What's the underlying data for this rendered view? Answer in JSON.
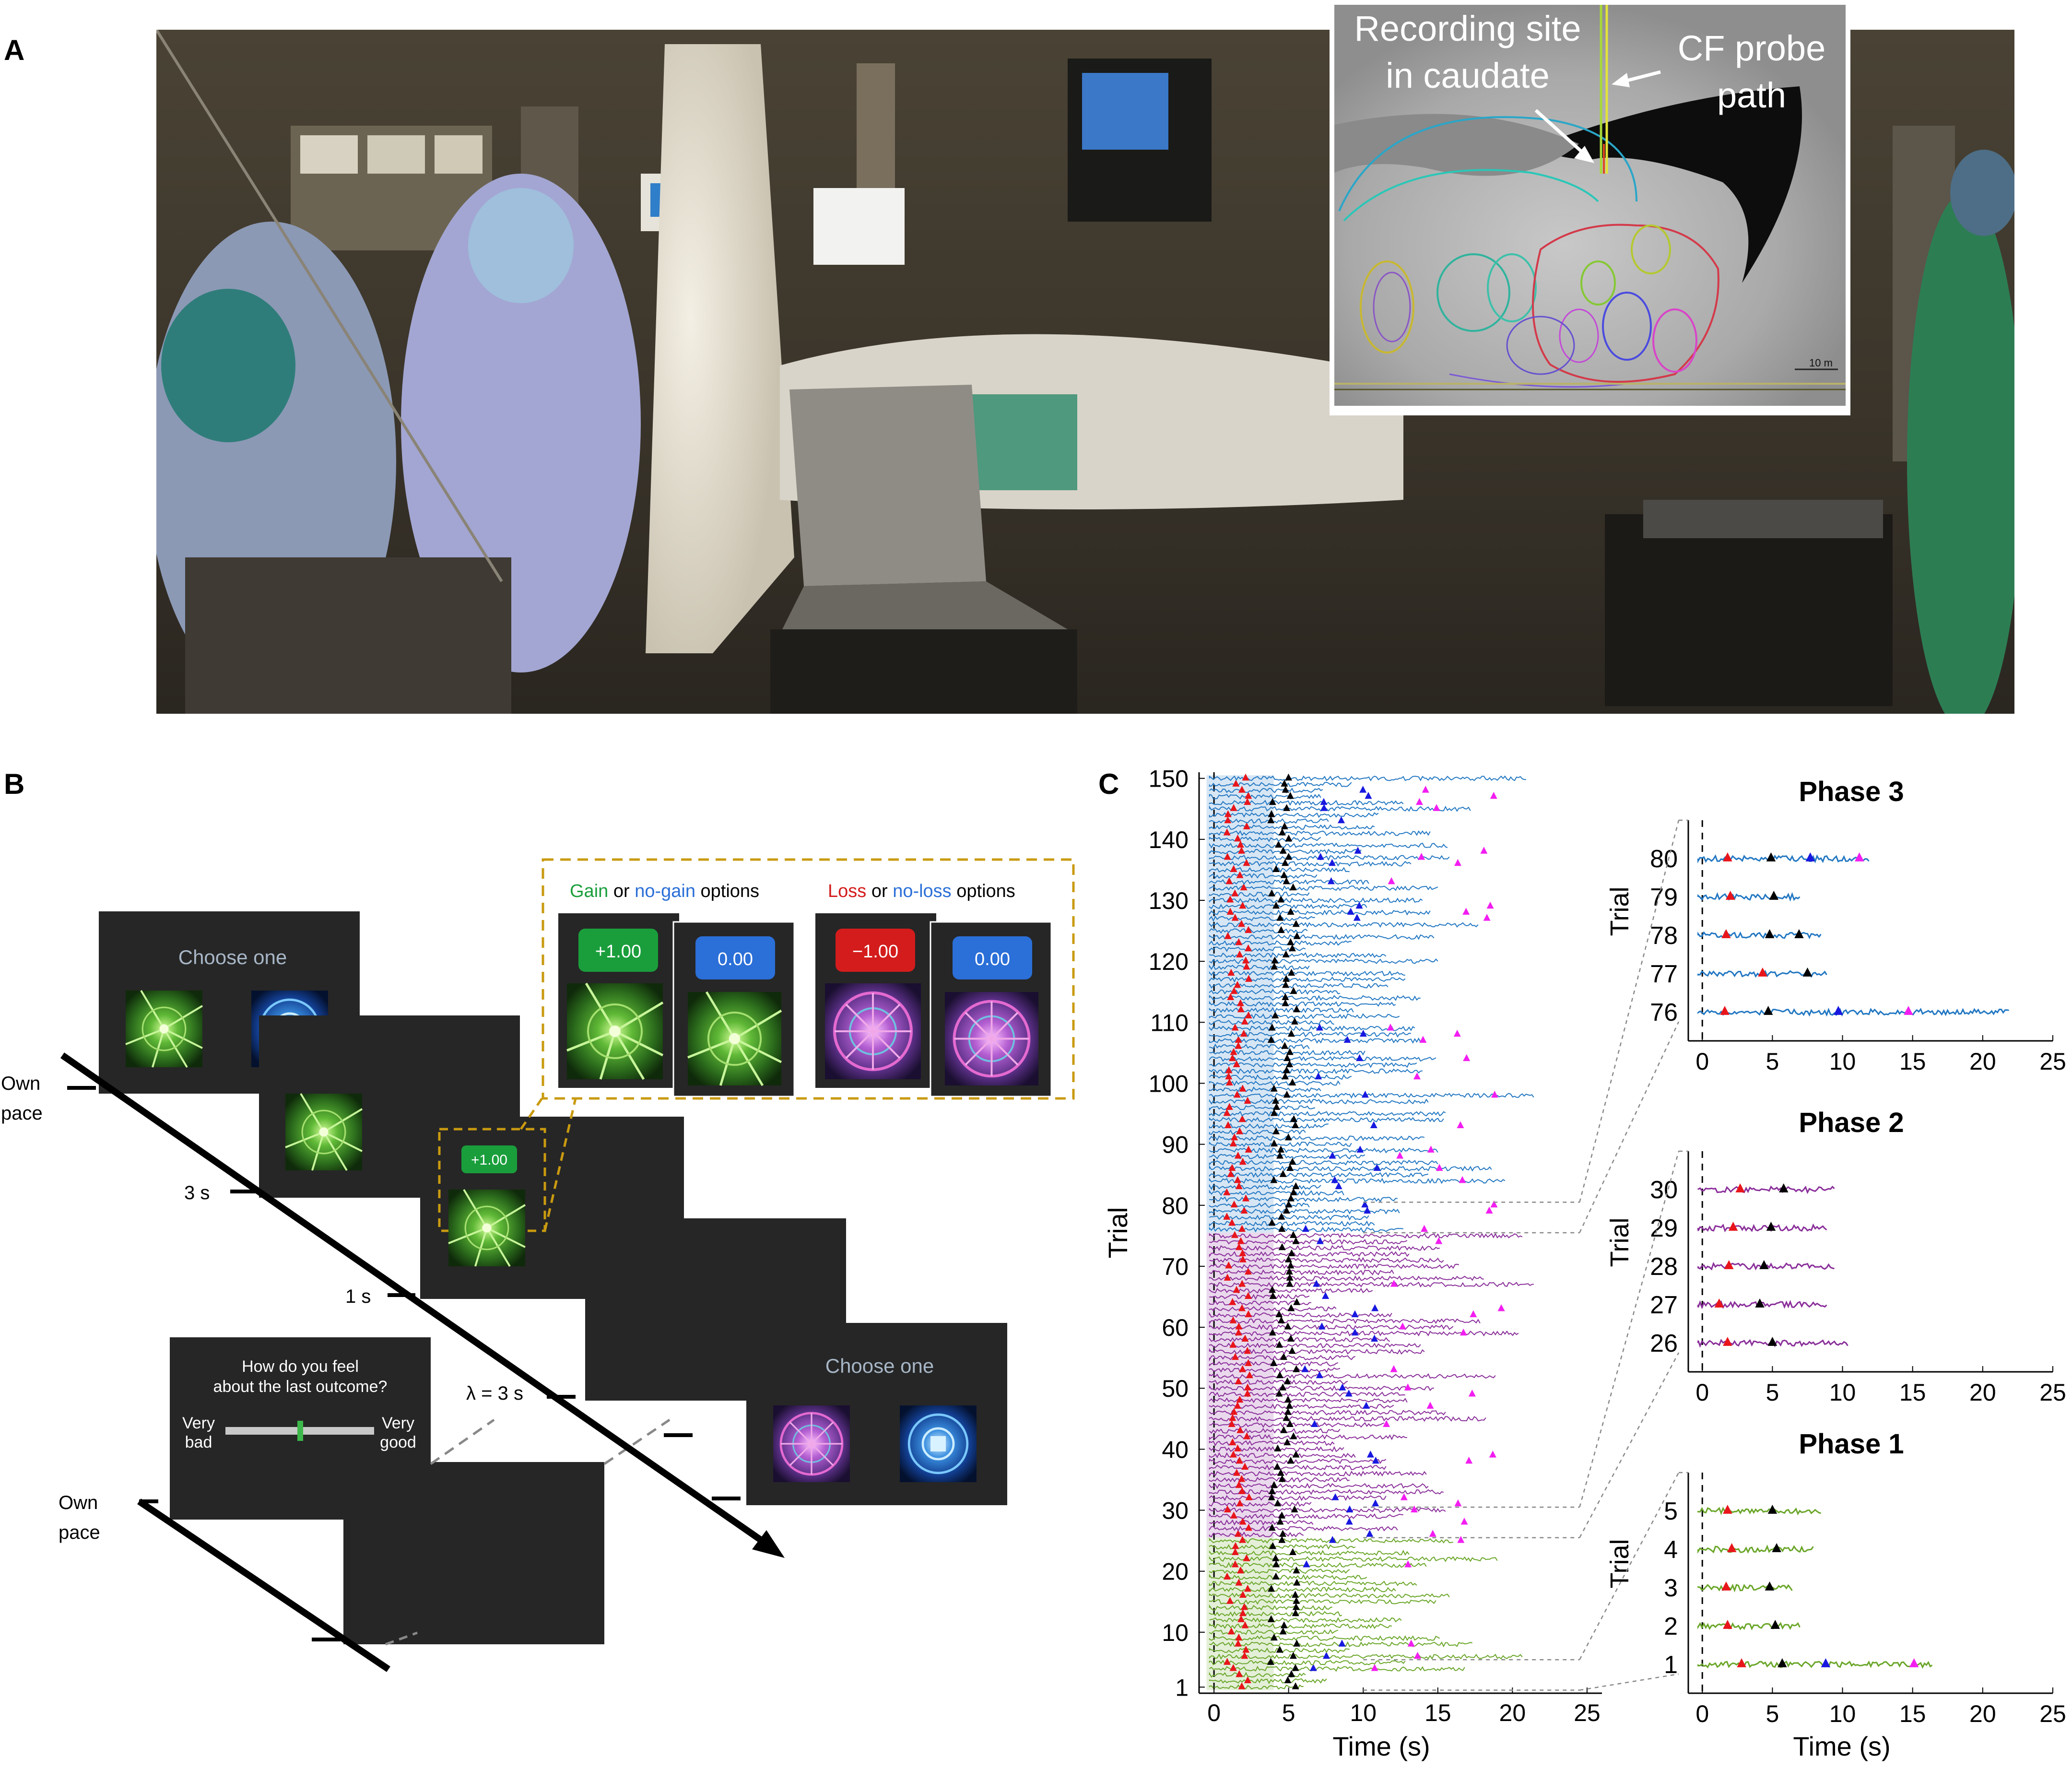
{
  "panels": {
    "a": "A",
    "b": "B",
    "c": "C"
  },
  "photo": {
    "inset_label_site": [
      "Recording site",
      "in caudate"
    ],
    "inset_label_probe": [
      "CF probe",
      "path"
    ],
    "scale_text": "10 m"
  },
  "task": {
    "choose_one": "Choose one",
    "gain_header": {
      "gain": "Gain",
      "or": " or ",
      "nogain": "no-gain",
      "options": " options"
    },
    "loss_header": {
      "loss": "Loss",
      "or": " or ",
      "noloss": "no-loss",
      "options": " options"
    },
    "gain_value": "+1.00",
    "nogain_value": "0.00",
    "loss_value": "−1.00",
    "noloss_value": "0.00",
    "outcome_value": "+1.00",
    "own_pace": [
      "Own",
      "pace"
    ],
    "t_3s": "3 s",
    "t_1s": "1 s",
    "t_lambda": "λ = 3 s",
    "rating_question": [
      "How do you feel",
      "about the last outcome?"
    ],
    "very_bad": [
      "Very",
      "bad"
    ],
    "very_good": [
      "Very",
      "good"
    ]
  },
  "colors": {
    "phase1": "#6aa629",
    "phase2": "#8a2f9a",
    "phase3": "#2277c2",
    "marker_red": "#e8151b",
    "marker_black": "#000000",
    "marker_blue": "#1818e0",
    "marker_magenta": "#f21ef0",
    "gain_green": "#1a9e3c",
    "nogain_blue": "#2b6fd8",
    "loss_red": "#d41c1c",
    "dashed_gold": "#c99a10"
  },
  "chart_data": [
    {
      "type": "line",
      "title": "",
      "xlabel": "Time (s)",
      "ylabel": "Trial",
      "xlim": [
        -1,
        26
      ],
      "ylim": [
        0,
        151
      ],
      "xticks": [
        0,
        5,
        10,
        15,
        20,
        25
      ],
      "yticks": [
        1,
        10,
        20,
        30,
        40,
        50,
        60,
        70,
        80,
        90,
        100,
        110,
        120,
        130,
        140,
        150
      ],
      "phases": [
        {
          "name": "Phase 1",
          "trials": [
            1,
            25
          ]
        },
        {
          "name": "Phase 2",
          "trials": [
            26,
            75
          ]
        },
        {
          "name": "Phase 3",
          "trials": [
            76,
            150
          ]
        }
      ]
    },
    {
      "type": "line",
      "title": "Phase 3",
      "xlabel": "",
      "ylabel": "Trial",
      "xlim": [
        -1,
        25
      ],
      "xticks": [
        0,
        5,
        10,
        15,
        20,
        25
      ],
      "trials": [
        {
          "trial": 80,
          "end": 12,
          "red": 1.8,
          "black": 4.9,
          "blue": 7.7,
          "magenta": 11.2
        },
        {
          "trial": 79,
          "end": 7,
          "red": 2.0,
          "black": 5.1
        },
        {
          "trial": 78,
          "end": 8.5,
          "red": 1.7,
          "black": 4.8,
          "extra_black": 6.9
        },
        {
          "trial": 77,
          "end": 9,
          "red": 4.3,
          "black": 7.5
        },
        {
          "trial": 76,
          "end": 22,
          "red": 1.6,
          "black": 4.7,
          "blue": 9.7,
          "magenta": 14.7
        }
      ]
    },
    {
      "type": "line",
      "title": "Phase 2",
      "xlabel": "",
      "ylabel": "Trial",
      "xlim": [
        -1,
        25
      ],
      "xticks": [
        0,
        5,
        10,
        15,
        20,
        25
      ],
      "trials": [
        {
          "trial": 30,
          "end": 9.5,
          "red": 2.7,
          "black": 5.8
        },
        {
          "trial": 29,
          "end": 9,
          "red": 2.2,
          "black": 4.9
        },
        {
          "trial": 28,
          "end": 9.5,
          "red": 1.9,
          "black": 4.4
        },
        {
          "trial": 27,
          "end": 9,
          "red": 1.2,
          "black": 4.1
        },
        {
          "trial": 26,
          "end": 10.5,
          "red": 1.8,
          "black": 5.0
        }
      ]
    },
    {
      "type": "line",
      "title": "Phase 1",
      "xlabel": "Time (s)",
      "ylabel": "Trial",
      "xlim": [
        -1,
        25
      ],
      "xticks": [
        0,
        5,
        10,
        15,
        20,
        25
      ],
      "trials": [
        {
          "trial": 5,
          "end": 8.5,
          "red": 1.8,
          "black": 5.0
        },
        {
          "trial": 4,
          "end": 8,
          "red": 2.1,
          "black": 5.3
        },
        {
          "trial": 3,
          "end": 6.5,
          "red": 1.7,
          "black": 4.8
        },
        {
          "trial": 2,
          "end": 7,
          "red": 1.8,
          "black": 5.2
        },
        {
          "trial": 1,
          "end": 16.5,
          "red": 2.8,
          "black": 5.7,
          "blue": 8.8,
          "magenta": 15.1
        }
      ]
    }
  ]
}
